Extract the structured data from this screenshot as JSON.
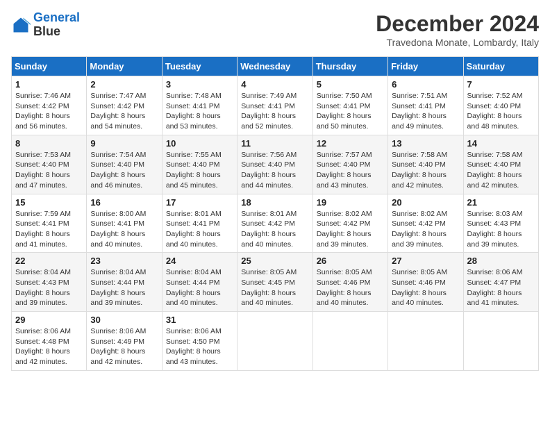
{
  "logo": {
    "line1": "General",
    "line2": "Blue"
  },
  "title": "December 2024",
  "subtitle": "Travedona Monate, Lombardy, Italy",
  "weekdays": [
    "Sunday",
    "Monday",
    "Tuesday",
    "Wednesday",
    "Thursday",
    "Friday",
    "Saturday"
  ],
  "weeks": [
    [
      {
        "day": "1",
        "sunrise": "7:46 AM",
        "sunset": "4:42 PM",
        "daylight": "8 hours and 56 minutes."
      },
      {
        "day": "2",
        "sunrise": "7:47 AM",
        "sunset": "4:42 PM",
        "daylight": "8 hours and 54 minutes."
      },
      {
        "day": "3",
        "sunrise": "7:48 AM",
        "sunset": "4:41 PM",
        "daylight": "8 hours and 53 minutes."
      },
      {
        "day": "4",
        "sunrise": "7:49 AM",
        "sunset": "4:41 PM",
        "daylight": "8 hours and 52 minutes."
      },
      {
        "day": "5",
        "sunrise": "7:50 AM",
        "sunset": "4:41 PM",
        "daylight": "8 hours and 50 minutes."
      },
      {
        "day": "6",
        "sunrise": "7:51 AM",
        "sunset": "4:41 PM",
        "daylight": "8 hours and 49 minutes."
      },
      {
        "day": "7",
        "sunrise": "7:52 AM",
        "sunset": "4:40 PM",
        "daylight": "8 hours and 48 minutes."
      }
    ],
    [
      {
        "day": "8",
        "sunrise": "7:53 AM",
        "sunset": "4:40 PM",
        "daylight": "8 hours and 47 minutes."
      },
      {
        "day": "9",
        "sunrise": "7:54 AM",
        "sunset": "4:40 PM",
        "daylight": "8 hours and 46 minutes."
      },
      {
        "day": "10",
        "sunrise": "7:55 AM",
        "sunset": "4:40 PM",
        "daylight": "8 hours and 45 minutes."
      },
      {
        "day": "11",
        "sunrise": "7:56 AM",
        "sunset": "4:40 PM",
        "daylight": "8 hours and 44 minutes."
      },
      {
        "day": "12",
        "sunrise": "7:57 AM",
        "sunset": "4:40 PM",
        "daylight": "8 hours and 43 minutes."
      },
      {
        "day": "13",
        "sunrise": "7:58 AM",
        "sunset": "4:40 PM",
        "daylight": "8 hours and 42 minutes."
      },
      {
        "day": "14",
        "sunrise": "7:58 AM",
        "sunset": "4:40 PM",
        "daylight": "8 hours and 42 minutes."
      }
    ],
    [
      {
        "day": "15",
        "sunrise": "7:59 AM",
        "sunset": "4:41 PM",
        "daylight": "8 hours and 41 minutes."
      },
      {
        "day": "16",
        "sunrise": "8:00 AM",
        "sunset": "4:41 PM",
        "daylight": "8 hours and 40 minutes."
      },
      {
        "day": "17",
        "sunrise": "8:01 AM",
        "sunset": "4:41 PM",
        "daylight": "8 hours and 40 minutes."
      },
      {
        "day": "18",
        "sunrise": "8:01 AM",
        "sunset": "4:42 PM",
        "daylight": "8 hours and 40 minutes."
      },
      {
        "day": "19",
        "sunrise": "8:02 AM",
        "sunset": "4:42 PM",
        "daylight": "8 hours and 39 minutes."
      },
      {
        "day": "20",
        "sunrise": "8:02 AM",
        "sunset": "4:42 PM",
        "daylight": "8 hours and 39 minutes."
      },
      {
        "day": "21",
        "sunrise": "8:03 AM",
        "sunset": "4:43 PM",
        "daylight": "8 hours and 39 minutes."
      }
    ],
    [
      {
        "day": "22",
        "sunrise": "8:04 AM",
        "sunset": "4:43 PM",
        "daylight": "8 hours and 39 minutes."
      },
      {
        "day": "23",
        "sunrise": "8:04 AM",
        "sunset": "4:44 PM",
        "daylight": "8 hours and 39 minutes."
      },
      {
        "day": "24",
        "sunrise": "8:04 AM",
        "sunset": "4:44 PM",
        "daylight": "8 hours and 40 minutes."
      },
      {
        "day": "25",
        "sunrise": "8:05 AM",
        "sunset": "4:45 PM",
        "daylight": "8 hours and 40 minutes."
      },
      {
        "day": "26",
        "sunrise": "8:05 AM",
        "sunset": "4:46 PM",
        "daylight": "8 hours and 40 minutes."
      },
      {
        "day": "27",
        "sunrise": "8:05 AM",
        "sunset": "4:46 PM",
        "daylight": "8 hours and 40 minutes."
      },
      {
        "day": "28",
        "sunrise": "8:06 AM",
        "sunset": "4:47 PM",
        "daylight": "8 hours and 41 minutes."
      }
    ],
    [
      {
        "day": "29",
        "sunrise": "8:06 AM",
        "sunset": "4:48 PM",
        "daylight": "8 hours and 42 minutes."
      },
      {
        "day": "30",
        "sunrise": "8:06 AM",
        "sunset": "4:49 PM",
        "daylight": "8 hours and 42 minutes."
      },
      {
        "day": "31",
        "sunrise": "8:06 AM",
        "sunset": "4:50 PM",
        "daylight": "8 hours and 43 minutes."
      },
      null,
      null,
      null,
      null
    ]
  ],
  "labels": {
    "sunrise": "Sunrise: ",
    "sunset": "Sunset: ",
    "daylight": "Daylight: "
  }
}
